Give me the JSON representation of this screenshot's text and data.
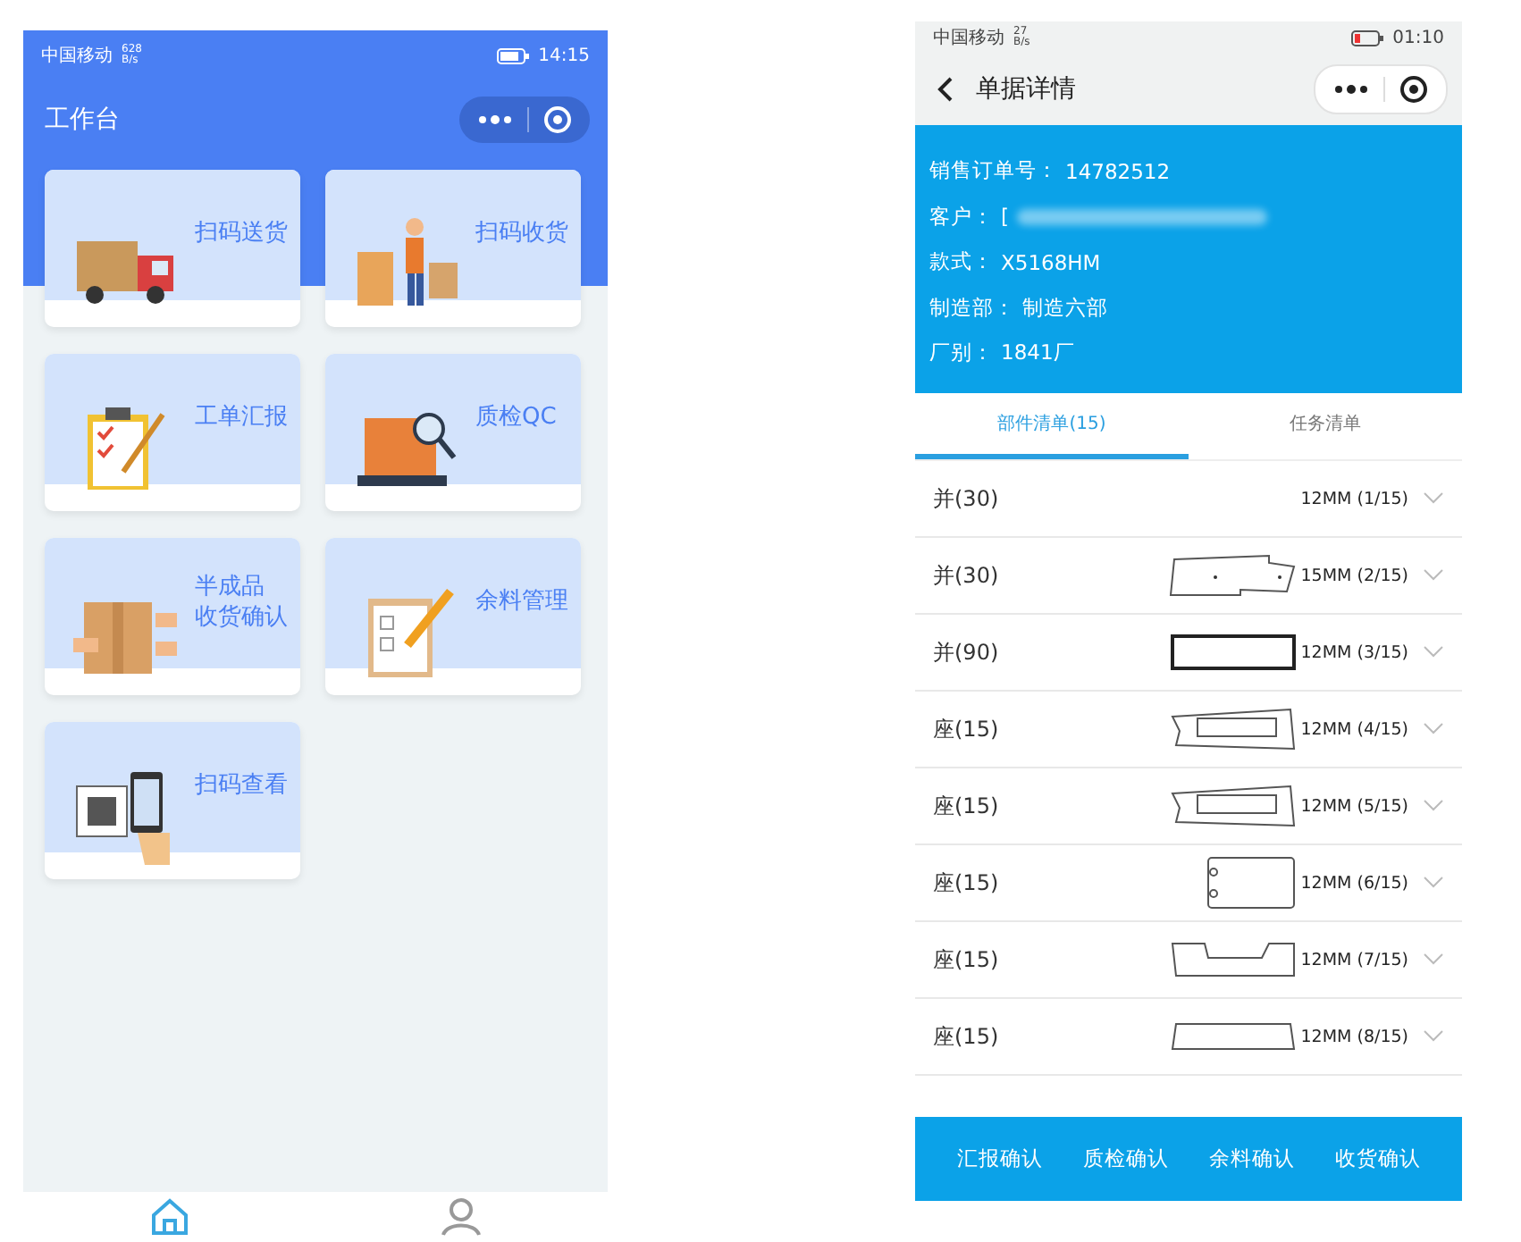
{
  "left_screen": {
    "status_bar": {
      "carrier": "中国移动",
      "speed": "628 B/s",
      "time": "14:15"
    },
    "title": "工作台",
    "tiles": [
      {
        "label": [
          "扫码送货"
        ]
      },
      {
        "label": [
          "扫码收货"
        ]
      },
      {
        "label": [
          "工单汇报"
        ]
      },
      {
        "label": [
          "质检QC"
        ]
      },
      {
        "label": [
          "半成品",
          "收货确认"
        ]
      },
      {
        "label": [
          "余料管理"
        ]
      },
      {
        "label": [
          "扫码查看"
        ]
      }
    ],
    "tab_bar": [
      {
        "selected": true
      },
      {
        "selected": false
      }
    ]
  },
  "right_screen": {
    "status_bar": {
      "carrier": "中国移动",
      "speed": "27 B/s",
      "time": "01:10"
    },
    "title": "单据详情",
    "info": [
      {
        "label": "销售订单号：",
        "value": "14782512",
        "redacted": false
      },
      {
        "label": "客户：",
        "value": "[",
        "redacted": true
      },
      {
        "label": "款式：",
        "value": "X5168HM",
        "redacted": false
      },
      {
        "label": "制造部：",
        "value": "制造六部",
        "redacted": false
      },
      {
        "label": "厂别：",
        "value": "1841厂",
        "redacted": false
      }
    ],
    "tabs": [
      {
        "label": "部件清单(15)",
        "selected": true
      },
      {
        "label": "任务清单",
        "selected": false
      }
    ],
    "parts": [
      {
        "name": "并(30)",
        "spec": "12MM (1/15)",
        "kind": "plain"
      },
      {
        "name": "并(30)",
        "spec": "15MM (2/15)",
        "kind": "notched"
      },
      {
        "name": "并(90)",
        "spec": "12MM (3/15)",
        "kind": "rect"
      },
      {
        "name": "座(15)",
        "spec": "12MM (4/15)",
        "kind": "slot"
      },
      {
        "name": "座(15)",
        "spec": "12MM (5/15)",
        "kind": "slot"
      },
      {
        "name": "座(15)",
        "spec": "12MM (6/15)",
        "kind": "holes"
      },
      {
        "name": "座(15)",
        "spec": "12MM (7/15)",
        "kind": "channel"
      },
      {
        "name": "座(15)",
        "spec": "12MM (8/15)",
        "kind": "flat"
      }
    ],
    "actions": [
      "汇报确认",
      "质检确认",
      "余料确认",
      "收货确认"
    ]
  }
}
